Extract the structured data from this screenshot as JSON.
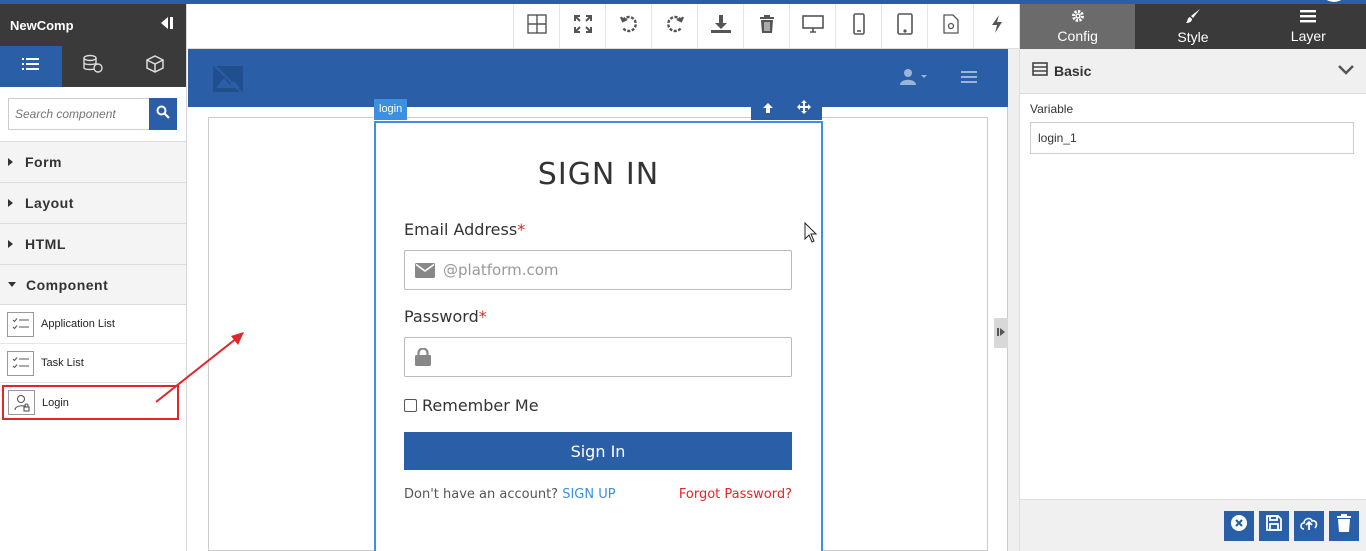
{
  "app": {
    "title": "NewComp"
  },
  "sidebar": {
    "search_placeholder": "Search component",
    "categories": [
      {
        "label": "Form"
      },
      {
        "label": "Layout"
      },
      {
        "label": "HTML"
      },
      {
        "label": "Component"
      }
    ],
    "components": [
      {
        "label": "Application List"
      },
      {
        "label": "Task List"
      },
      {
        "label": "Login"
      }
    ]
  },
  "canvas": {
    "login_tag": "login",
    "form": {
      "title": "SIGN IN",
      "email_label": "Email Address",
      "email_placeholder": "@platform.com",
      "password_label": "Password",
      "required_mark": "*",
      "remember_label": "Remember Me",
      "signin_label": "Sign In",
      "no_account_text": "Don't have an account?",
      "signup_label": "SIGN UP",
      "forgot_label": "Forgot Password?"
    }
  },
  "right_panel": {
    "tabs": [
      {
        "label": "Config",
        "icon": "gear-icon"
      },
      {
        "label": "Style",
        "icon": "brush-icon"
      },
      {
        "label": "Layer",
        "icon": "layers-icon"
      }
    ],
    "section_title": "Basic",
    "variable_label": "Variable",
    "variable_value": "login_1"
  },
  "colors": {
    "primary": "#2a5fa8",
    "accent": "#3d8fe0",
    "danger": "#e0262b",
    "dark": "#3a3a3a"
  }
}
